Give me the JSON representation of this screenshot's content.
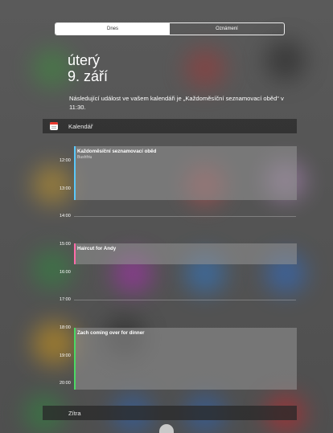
{
  "tabs": [
    {
      "label": "Dnes",
      "selected": true
    },
    {
      "label": "Oznámení",
      "selected": false
    }
  ],
  "today": {
    "weekday": "úterý",
    "date": "9. září",
    "next_event": "Následující událost ve vašem kalendáři je „Každoměsíční seznamovací oběd“ v 11:30."
  },
  "calendar": {
    "header": "Kalendář",
    "icon": "calendar-icon",
    "hours": [
      "12:00",
      "13:00",
      "14:00",
      "15:00",
      "16:00",
      "17:00",
      "18:00",
      "19:00",
      "20:00"
    ],
    "events": [
      {
        "title": "Každoměsíční seznamovací oběd",
        "location": "Bushfriu",
        "color": "#5ac8fa"
      },
      {
        "title": "Haircut for Andy",
        "location": "",
        "color": "#ff6ca8"
      },
      {
        "title": "Zach coming over for dinner",
        "location": "",
        "color": "#4cd964"
      }
    ]
  },
  "tomorrow": {
    "label": "Zítra"
  }
}
